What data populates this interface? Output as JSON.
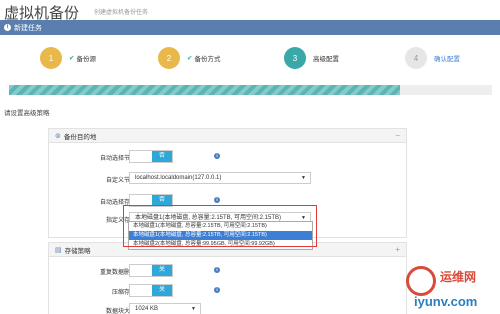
{
  "page": {
    "title": "虚拟机备份",
    "subtitle": "创建虚拟机备份任务"
  },
  "panel": {
    "title": "新建任务"
  },
  "steps": [
    {
      "number": "1",
      "label": "备份源",
      "status": "done",
      "color": "#e8b84a"
    },
    {
      "number": "2",
      "label": "备份方式",
      "status": "done",
      "color": "#e8b84a"
    },
    {
      "number": "3",
      "label": "高级配置",
      "status": "active",
      "color": "#3aa8a8"
    },
    {
      "number": "4",
      "label": "确认配置",
      "status": "pending",
      "color": "#e6e6e6"
    }
  ],
  "progress": {
    "fraction": 0.81,
    "color": "#5ab5b5"
  },
  "section_heading": "请设置高级策略",
  "backup_target": {
    "title": "备份目的地",
    "toggle_symbol": "−",
    "rows": {
      "auto_node": {
        "label": "自动选择节点",
        "value": "否"
      },
      "custom_node": {
        "label": "自定义节点",
        "value": "localhost.localdomain(127.0.0.1)"
      },
      "auto_storage": {
        "label": "自动选择存储",
        "value": "否"
      },
      "custom_storage": {
        "label": "指定义存储",
        "value": "本地磁盘1(本地磁盘, 总容量:2.15TB, 可用空间:2.15TB)"
      }
    },
    "dropdown_options": [
      "本地磁盘1(本地磁盘, 总容量:2.15TB, 可用空间:2.15TB)",
      "本地磁盘1(本地磁盘, 总容量:2.15TB, 可用空间:2.15TB)",
      "本地磁盘2(本地磁盘, 总容量:99.95GB, 可用空间:99.92GB)"
    ],
    "selected_option_index": 1
  },
  "storage_policy": {
    "title": "存储策略",
    "toggle_symbol": "+",
    "rows": {
      "dedupe": {
        "label": "重复数据删除",
        "value": "关"
      },
      "compress": {
        "label": "压缩存储",
        "value": "关"
      },
      "block_size": {
        "label": "数据块大小",
        "value": "1024 KB"
      }
    }
  },
  "watermark": {
    "cn": "运维网",
    "en": "iyunv.com"
  },
  "colors": {
    "header": "#5a7fae",
    "switch": "#2ea8d8",
    "selection": "#3e7fd6",
    "highlight": "#e23a3a"
  }
}
